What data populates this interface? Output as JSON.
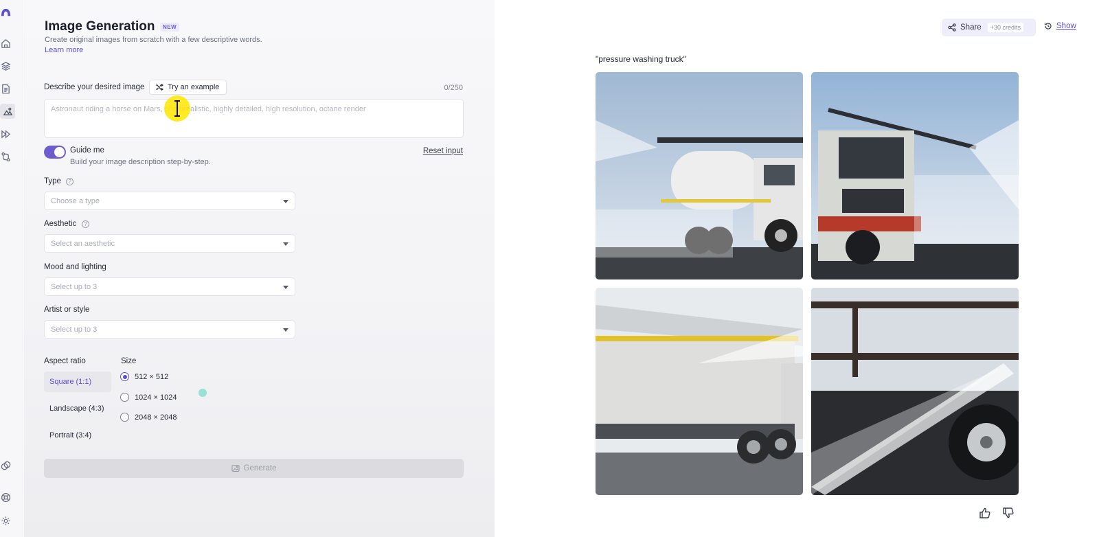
{
  "rail": {
    "items": [
      {
        "name": "logo-icon"
      },
      {
        "name": "home-icon"
      },
      {
        "name": "layers-icon"
      },
      {
        "name": "document-icon"
      },
      {
        "name": "image-generation-icon"
      },
      {
        "name": "fast-forward-icon"
      },
      {
        "name": "workflow-icon"
      },
      {
        "name": "community-icon"
      },
      {
        "name": "help-icon"
      },
      {
        "name": "settings-icon"
      }
    ]
  },
  "form": {
    "title": "Image Generation",
    "badge": "NEW",
    "subtitle": "Create original images from scratch with a few descriptive words.",
    "learn_more": "Learn more",
    "describe_label": "Describe your desired image",
    "try_example": "Try an example",
    "counter": "0/250",
    "prompt_placeholder": "Astronaut riding a horse on Mars, photorealistic, highly detailed, high resolution, octane render",
    "prompt_value": "",
    "guide_me": {
      "title": "Guide me",
      "subtitle": "Build your image description step-by-step.",
      "enabled": true
    },
    "reset_input": "Reset input",
    "type": {
      "label": "Type",
      "placeholder": "Choose a type"
    },
    "aesthetic": {
      "label": "Aesthetic",
      "placeholder": "Select an aesthetic"
    },
    "mood": {
      "label": "Mood and lighting",
      "placeholder": "Select up to 3"
    },
    "artist": {
      "label": "Artist or style",
      "placeholder": "Select up to 3"
    },
    "aspect_ratio": {
      "label": "Aspect ratio",
      "options": [
        "Square (1:1)",
        "Landscape (4:3)",
        "Portrait (3:4)"
      ],
      "selected": "Square (1:1)"
    },
    "size": {
      "label": "Size",
      "options": [
        "512 × 512",
        "1024 × 1024",
        "2048 × 2048"
      ],
      "selected": "512 × 512"
    },
    "generate": "Generate"
  },
  "results": {
    "share": "Share",
    "credits": "+30 credits",
    "show": "Show",
    "caption": "\"pressure washing truck\"",
    "images": [
      {
        "name": "result-image-1",
        "subject": "white tanker truck spraying water, side view"
      },
      {
        "name": "result-image-2",
        "subject": "truck front with spray bar, water mist"
      },
      {
        "name": "result-image-3",
        "subject": "white box trailer truck with yellow rail"
      },
      {
        "name": "result-image-4",
        "subject": "close-up of truck wheel with water spray"
      }
    ]
  },
  "colors": {
    "accent": "#5b4fd6",
    "toggle": "#6d5bd0",
    "share_bg": "#eeedfb"
  }
}
